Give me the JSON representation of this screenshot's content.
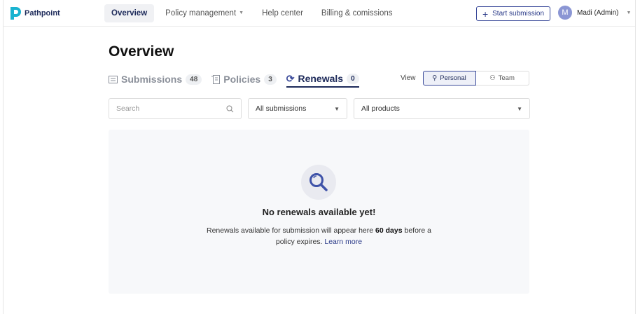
{
  "brand": {
    "name": "Pathpoint",
    "color": "#19b3d0"
  },
  "nav": {
    "items": [
      {
        "label": "Overview",
        "active": true
      },
      {
        "label": "Policy management",
        "dropdown": true
      },
      {
        "label": "Help center"
      },
      {
        "label": "Billing & comissions"
      }
    ]
  },
  "header": {
    "start_submission": "Start submission",
    "user": {
      "initial": "M",
      "name": "Madi (Admin)"
    }
  },
  "page": {
    "title": "Overview"
  },
  "tabs": [
    {
      "label": "Submissions",
      "count": "48",
      "icon": "inbox-icon"
    },
    {
      "label": "Policies",
      "count": "3",
      "icon": "scroll-icon"
    },
    {
      "label": "Renewals",
      "count": "0",
      "icon": "refresh-icon",
      "active": true
    }
  ],
  "view": {
    "label": "View",
    "options": [
      {
        "label": "Personal",
        "selected": true
      },
      {
        "label": "Team"
      }
    ]
  },
  "filters": {
    "search_placeholder": "Search",
    "submissions": "All submissions",
    "products": "All products"
  },
  "empty": {
    "title": "No renewals available yet!",
    "desc_before": "Renewals available for submission will appear here ",
    "desc_bold": "60 days",
    "desc_after": " before a policy expires. ",
    "link": "Learn more"
  },
  "colors": {
    "accent": "#1d2a5a",
    "link": "#2a3a88"
  }
}
